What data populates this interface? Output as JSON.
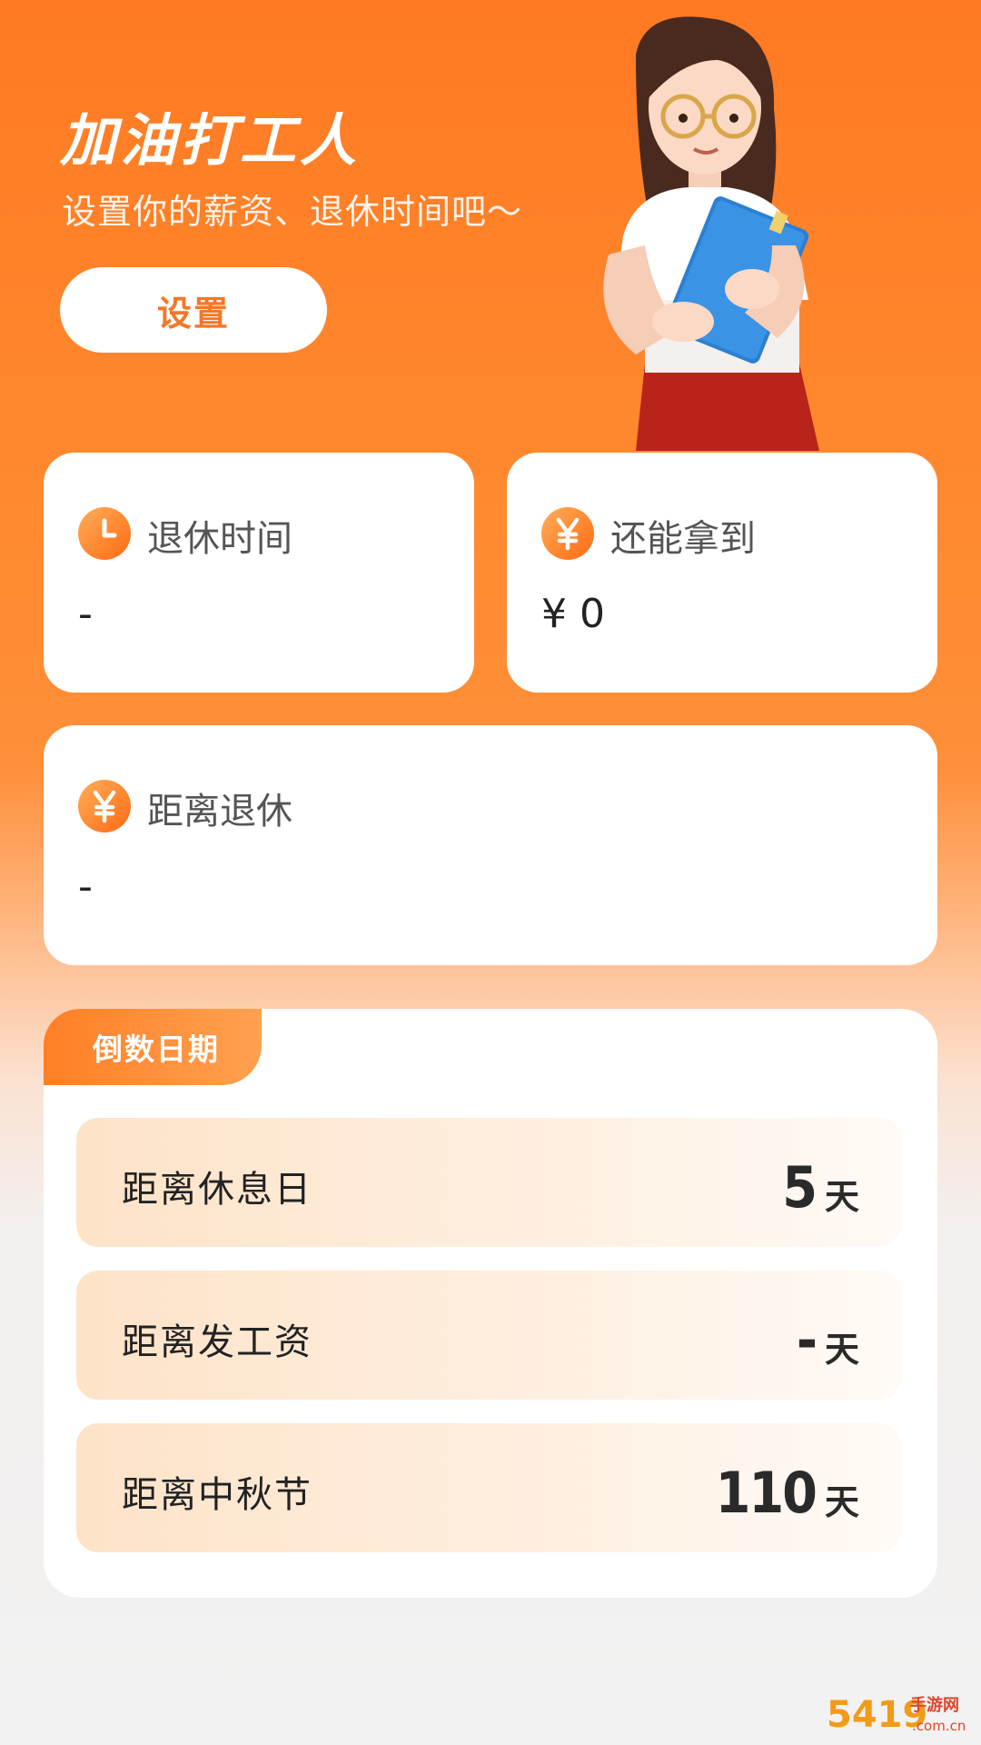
{
  "header": {
    "title": "加油打工人",
    "subtitle": "设置你的薪资、退休时间吧～",
    "setup_button": "设置"
  },
  "stats": {
    "retire_time": {
      "label": "退休时间",
      "value": "-",
      "icon": "clock-icon"
    },
    "still_earn": {
      "label": "还能拿到",
      "value": "¥ 0",
      "icon": "yen-icon"
    },
    "distance_retire": {
      "label": "距离退休",
      "value": "-",
      "icon": "yen-icon"
    }
  },
  "countdown": {
    "tab": "倒数日期",
    "rows": [
      {
        "label": "距离休息日",
        "value": "5",
        "unit": "天"
      },
      {
        "label": "距离发工资",
        "value": "-",
        "unit": "天"
      },
      {
        "label": "距离中秋节",
        "value": "110",
        "unit": "天"
      }
    ]
  },
  "watermark": {
    "brand": "5419",
    "site": "手游网",
    "domain": ".com.cn"
  },
  "colors": {
    "accent": "#ff7a22",
    "accent_light": "#ffa150",
    "card_bg": "#ffffff",
    "page_bg": "#f2f2f2"
  }
}
